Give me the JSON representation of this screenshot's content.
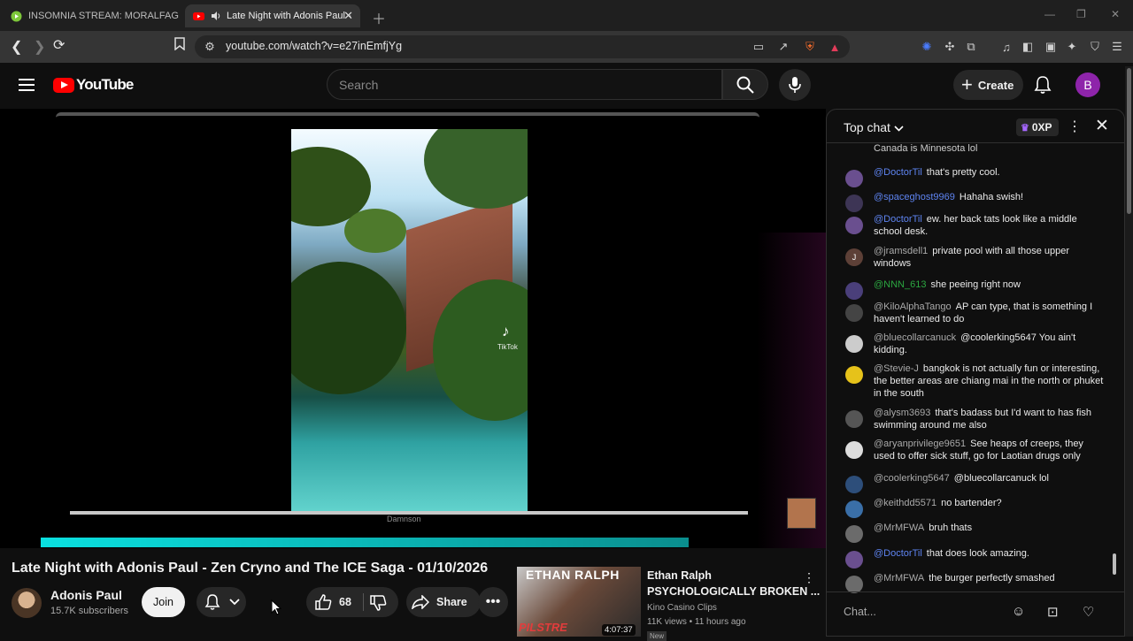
{
  "browser": {
    "tabs": [
      {
        "title": "INSOMNIA STREAM: MORALFAG ED",
        "active": false
      },
      {
        "title": "Late Night with Adonis Paul -",
        "active": true
      }
    ],
    "url": "youtube.com/watch?v=e27inEmfjYg"
  },
  "header": {
    "brand": "YouTube",
    "search_placeholder": "Search",
    "create_label": "Create",
    "avatar_letter": "B"
  },
  "player": {
    "caption": "Damnson",
    "tiktok_label": "TikTok",
    "progress": 0.78
  },
  "video": {
    "title": "Late Night with Adonis Paul - Zen Cryno and The ICE Saga - 01/10/2026",
    "channel": "Adonis Paul",
    "subscribers": "15.7K subscribers",
    "join_label": "Join",
    "likes": "68",
    "share_label": "Share"
  },
  "recommended": {
    "thumb_top": "ETHAN RALPH",
    "thumb_bottom": "PILSTRE",
    "duration": "4:07:37",
    "title_line1": "Ethan Ralph",
    "title_line2": "PSYCHOLOGICALLY BROKEN ...",
    "channel": "Kino Casino Clips",
    "meta": "11K views • 11 hours ago",
    "badge": "New"
  },
  "chat": {
    "header": "Top chat",
    "xp": "0XP",
    "input_placeholder": "Chat...",
    "partial_top": "Canada is Minnesota lol",
    "messages": [
      {
        "user": "@DoctorTil",
        "text": "that's pretty cool.",
        "color": "blue",
        "avatar": "#6a4f8f"
      },
      {
        "user": "@spaceghost9969",
        "text": "Hahaha swish!",
        "color": "blue",
        "avatar": "#3d3555"
      },
      {
        "user": "@DoctorTil",
        "text": "ew. her back tats look like a middle school desk.",
        "color": "blue",
        "avatar": "#6a4f8f"
      },
      {
        "user": "@jramsdell1",
        "text": "private pool with all those upper windows",
        "color": "grey",
        "avatar": "#5d4037",
        "letter": "J"
      },
      {
        "user": "@NNN_613",
        "text": "she peeing right now",
        "color": "green",
        "avatar": "#4a3f7a"
      },
      {
        "user": "@KiloAlphaTango",
        "text": "AP can type, that is something I haven't learned to do",
        "color": "grey",
        "avatar": "#444"
      },
      {
        "user": "@bluecollarcanuck",
        "text": "@coolerking5647 You ain't kidding.",
        "color": "grey",
        "avatar": "#ccc"
      },
      {
        "user": "@Stevie-J",
        "text": "bangkok is not actually fun or interesting, the better areas are chiang mai in the north or phuket in the south",
        "color": "grey",
        "avatar": "#e6c21a"
      },
      {
        "user": "@alysm3693",
        "text": "that's badass but I'd want to has fish swimming around me also",
        "color": "grey",
        "avatar": "#555"
      },
      {
        "user": "@aryanprivilege9651",
        "text": "See heaps of creeps, they used to offer sick stuff, go for Laotian drugs only",
        "color": "grey",
        "avatar": "#ddd"
      },
      {
        "user": "@coolerking5647",
        "text": "@bluecollarcanuck lol",
        "color": "grey",
        "avatar": "#2d4e7a"
      },
      {
        "user": "@keithdd5571",
        "text": "no bartender?",
        "color": "grey",
        "avatar": "#3a6fa8"
      },
      {
        "user": "@MrMFWA",
        "text": "bruh thats",
        "color": "grey",
        "avatar": "#6b6b6b"
      },
      {
        "user": "@DoctorTil",
        "text": "that does look amazing.",
        "color": "blue",
        "avatar": "#6a4f8f"
      },
      {
        "user": "@MrMFWA",
        "text": "the burger perfectly smashed",
        "color": "grey",
        "avatar": "#6b6b6b"
      }
    ]
  }
}
